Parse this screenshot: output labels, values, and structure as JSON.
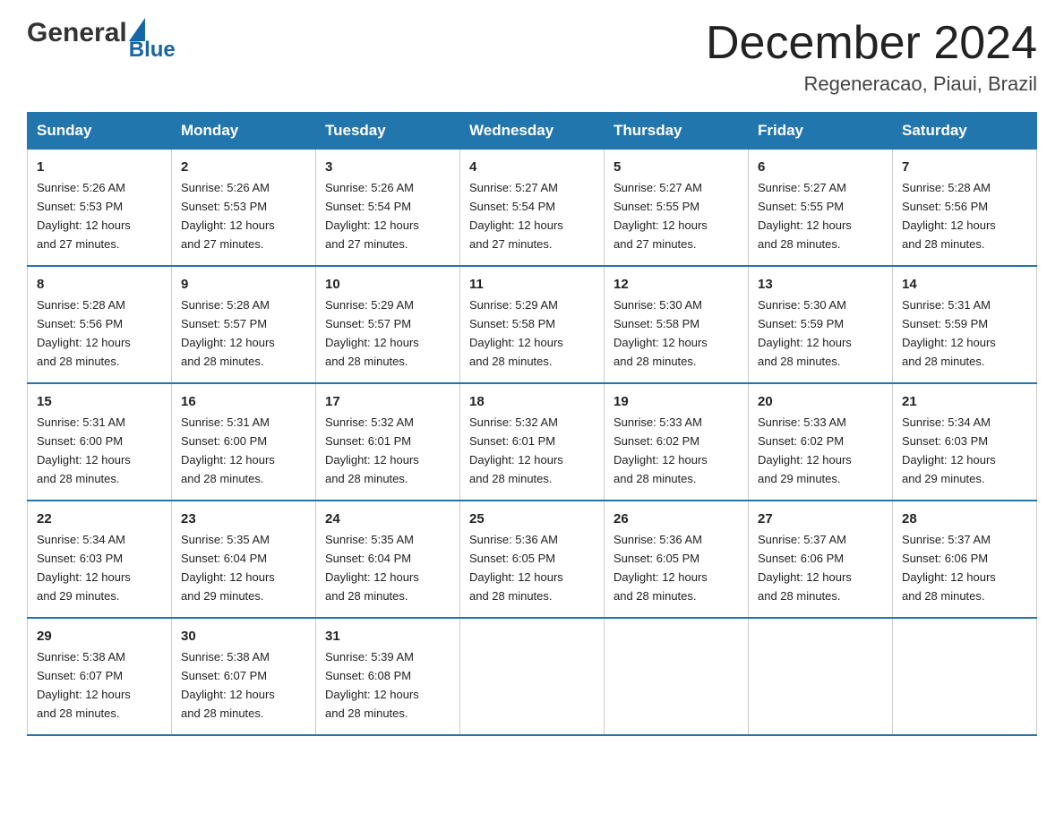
{
  "header": {
    "logo_general": "General",
    "logo_blue": "Blue",
    "title": "December 2024",
    "subtitle": "Regeneracao, Piaui, Brazil"
  },
  "weekdays": [
    "Sunday",
    "Monday",
    "Tuesday",
    "Wednesday",
    "Thursday",
    "Friday",
    "Saturday"
  ],
  "weeks": [
    [
      {
        "day": "1",
        "sunrise": "5:26 AM",
        "sunset": "5:53 PM",
        "daylight": "12 hours and 27 minutes."
      },
      {
        "day": "2",
        "sunrise": "5:26 AM",
        "sunset": "5:53 PM",
        "daylight": "12 hours and 27 minutes."
      },
      {
        "day": "3",
        "sunrise": "5:26 AM",
        "sunset": "5:54 PM",
        "daylight": "12 hours and 27 minutes."
      },
      {
        "day": "4",
        "sunrise": "5:27 AM",
        "sunset": "5:54 PM",
        "daylight": "12 hours and 27 minutes."
      },
      {
        "day": "5",
        "sunrise": "5:27 AM",
        "sunset": "5:55 PM",
        "daylight": "12 hours and 27 minutes."
      },
      {
        "day": "6",
        "sunrise": "5:27 AM",
        "sunset": "5:55 PM",
        "daylight": "12 hours and 28 minutes."
      },
      {
        "day": "7",
        "sunrise": "5:28 AM",
        "sunset": "5:56 PM",
        "daylight": "12 hours and 28 minutes."
      }
    ],
    [
      {
        "day": "8",
        "sunrise": "5:28 AM",
        "sunset": "5:56 PM",
        "daylight": "12 hours and 28 minutes."
      },
      {
        "day": "9",
        "sunrise": "5:28 AM",
        "sunset": "5:57 PM",
        "daylight": "12 hours and 28 minutes."
      },
      {
        "day": "10",
        "sunrise": "5:29 AM",
        "sunset": "5:57 PM",
        "daylight": "12 hours and 28 minutes."
      },
      {
        "day": "11",
        "sunrise": "5:29 AM",
        "sunset": "5:58 PM",
        "daylight": "12 hours and 28 minutes."
      },
      {
        "day": "12",
        "sunrise": "5:30 AM",
        "sunset": "5:58 PM",
        "daylight": "12 hours and 28 minutes."
      },
      {
        "day": "13",
        "sunrise": "5:30 AM",
        "sunset": "5:59 PM",
        "daylight": "12 hours and 28 minutes."
      },
      {
        "day": "14",
        "sunrise": "5:31 AM",
        "sunset": "5:59 PM",
        "daylight": "12 hours and 28 minutes."
      }
    ],
    [
      {
        "day": "15",
        "sunrise": "5:31 AM",
        "sunset": "6:00 PM",
        "daylight": "12 hours and 28 minutes."
      },
      {
        "day": "16",
        "sunrise": "5:31 AM",
        "sunset": "6:00 PM",
        "daylight": "12 hours and 28 minutes."
      },
      {
        "day": "17",
        "sunrise": "5:32 AM",
        "sunset": "6:01 PM",
        "daylight": "12 hours and 28 minutes."
      },
      {
        "day": "18",
        "sunrise": "5:32 AM",
        "sunset": "6:01 PM",
        "daylight": "12 hours and 28 minutes."
      },
      {
        "day": "19",
        "sunrise": "5:33 AM",
        "sunset": "6:02 PM",
        "daylight": "12 hours and 28 minutes."
      },
      {
        "day": "20",
        "sunrise": "5:33 AM",
        "sunset": "6:02 PM",
        "daylight": "12 hours and 29 minutes."
      },
      {
        "day": "21",
        "sunrise": "5:34 AM",
        "sunset": "6:03 PM",
        "daylight": "12 hours and 29 minutes."
      }
    ],
    [
      {
        "day": "22",
        "sunrise": "5:34 AM",
        "sunset": "6:03 PM",
        "daylight": "12 hours and 29 minutes."
      },
      {
        "day": "23",
        "sunrise": "5:35 AM",
        "sunset": "6:04 PM",
        "daylight": "12 hours and 29 minutes."
      },
      {
        "day": "24",
        "sunrise": "5:35 AM",
        "sunset": "6:04 PM",
        "daylight": "12 hours and 28 minutes."
      },
      {
        "day": "25",
        "sunrise": "5:36 AM",
        "sunset": "6:05 PM",
        "daylight": "12 hours and 28 minutes."
      },
      {
        "day": "26",
        "sunrise": "5:36 AM",
        "sunset": "6:05 PM",
        "daylight": "12 hours and 28 minutes."
      },
      {
        "day": "27",
        "sunrise": "5:37 AM",
        "sunset": "6:06 PM",
        "daylight": "12 hours and 28 minutes."
      },
      {
        "day": "28",
        "sunrise": "5:37 AM",
        "sunset": "6:06 PM",
        "daylight": "12 hours and 28 minutes."
      }
    ],
    [
      {
        "day": "29",
        "sunrise": "5:38 AM",
        "sunset": "6:07 PM",
        "daylight": "12 hours and 28 minutes."
      },
      {
        "day": "30",
        "sunrise": "5:38 AM",
        "sunset": "6:07 PM",
        "daylight": "12 hours and 28 minutes."
      },
      {
        "day": "31",
        "sunrise": "5:39 AM",
        "sunset": "6:08 PM",
        "daylight": "12 hours and 28 minutes."
      },
      null,
      null,
      null,
      null
    ]
  ],
  "labels": {
    "sunrise": "Sunrise: ",
    "sunset": "Sunset: ",
    "daylight": "Daylight: "
  }
}
